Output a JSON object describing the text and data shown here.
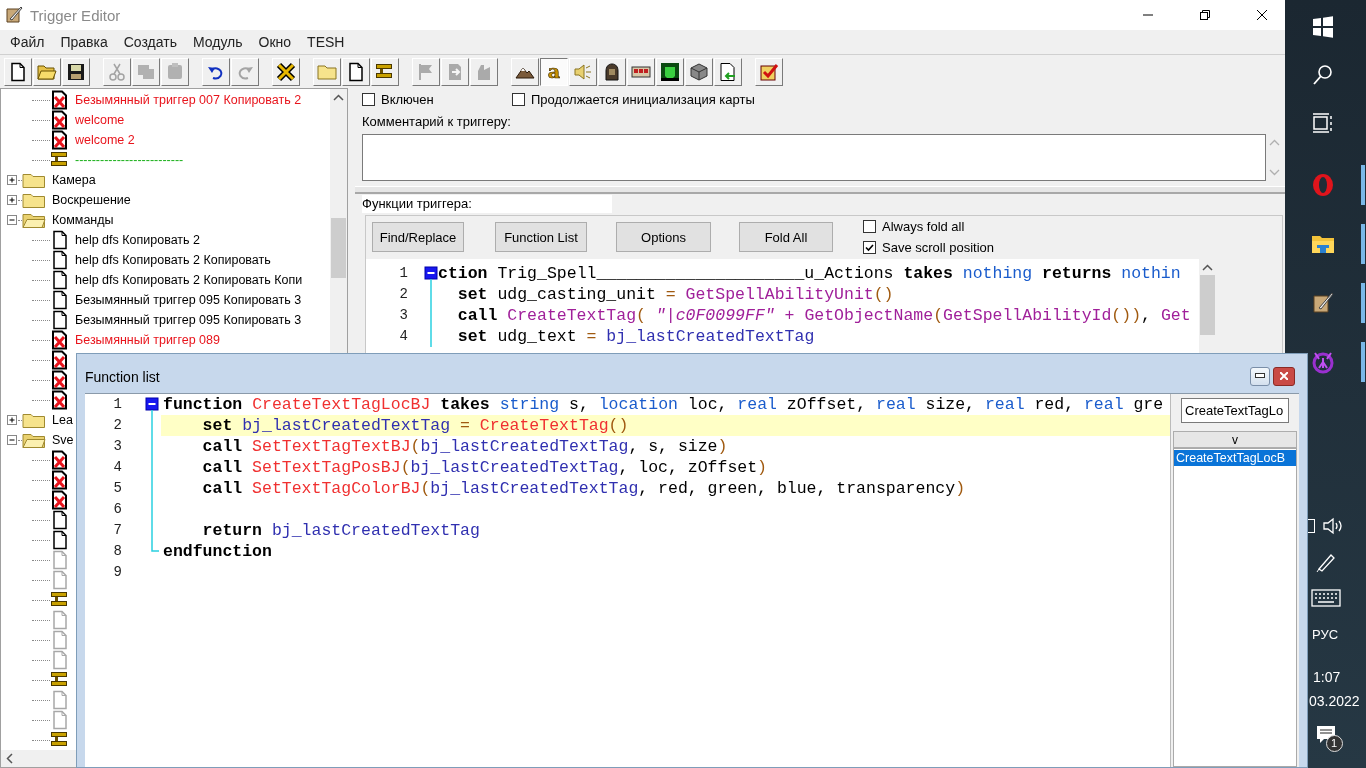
{
  "window": {
    "title": "Trigger Editor"
  },
  "menu": [
    "Файл",
    "Правка",
    "Создать",
    "Модуль",
    "Окно",
    "TESH"
  ],
  "toolbar": [
    [
      {
        "kind": "new",
        "disabled": false
      },
      {
        "kind": "open",
        "disabled": false
      },
      {
        "kind": "save",
        "disabled": false
      }
    ],
    [
      {
        "kind": "cut",
        "disabled": true
      },
      {
        "kind": "copy",
        "disabled": true
      },
      {
        "kind": "paste",
        "disabled": true
      }
    ],
    [
      {
        "kind": "undo",
        "disabled": false
      },
      {
        "kind": "redo",
        "disabled": true
      }
    ],
    [
      {
        "kind": "delete",
        "disabled": false
      }
    ],
    [
      {
        "kind": "folder",
        "disabled": false
      },
      {
        "kind": "trigger",
        "disabled": false
      },
      {
        "kind": "comment",
        "disabled": false
      }
    ],
    [
      {
        "kind": "flag",
        "disabled": true
      },
      {
        "kind": "export",
        "disabled": true
      },
      {
        "kind": "glove",
        "disabled": true
      }
    ],
    [
      {
        "kind": "terrain",
        "disabled": false,
        "pressed": false
      },
      {
        "kind": "text",
        "label": "a",
        "disabled": false,
        "pressed": true
      },
      {
        "kind": "sound",
        "disabled": false,
        "pressed": false
      },
      {
        "kind": "figure",
        "disabled": false,
        "pressed": false
      },
      {
        "kind": "panel",
        "disabled": false,
        "pressed": false
      },
      {
        "kind": "monster",
        "disabled": false,
        "pressed": false
      },
      {
        "kind": "cube",
        "disabled": false,
        "pressed": false
      },
      {
        "kind": "import",
        "disabled": false,
        "pressed": false
      }
    ],
    [
      {
        "kind": "check",
        "disabled": false
      }
    ]
  ],
  "tree": {
    "scrolled_children": [
      {
        "kind": "disabled",
        "label": "Безымянный триггер 007 Копировать 2"
      },
      {
        "kind": "disabled",
        "label": "welcome"
      },
      {
        "kind": "disabled",
        "label": "welcome 2"
      },
      {
        "kind": "comment",
        "label": "--------------------------"
      }
    ],
    "items": [
      {
        "kind": "folder",
        "label": "Камера",
        "expanded": false
      },
      {
        "kind": "folder",
        "label": "Воскрешение",
        "expanded": false
      },
      {
        "kind": "folder",
        "label": "Комманды",
        "expanded": true,
        "children": [
          {
            "kind": "enabled",
            "label": "help dfs Копировать 2"
          },
          {
            "kind": "enabled",
            "label": "help dfs Копировать 2 Копировать"
          },
          {
            "kind": "enabled",
            "label": "help dfs Копировать 2 Копировать Копи"
          },
          {
            "kind": "enabled",
            "label": "Безымянный триггер 095 Копировать 3"
          },
          {
            "kind": "enabled",
            "label": "Безымянный триггер 095 Копировать 3"
          },
          {
            "kind": "disabled",
            "label": "Безымянный триггер 089"
          },
          {
            "kind": "disabled"
          },
          {
            "kind": "disabled"
          },
          {
            "kind": "disabled"
          }
        ]
      },
      {
        "kind": "folder",
        "label": "Lea",
        "expanded": false
      },
      {
        "kind": "folder",
        "label": "Sve",
        "expanded": true,
        "children": [
          {
            "kind": "disabled"
          },
          {
            "kind": "disabled"
          },
          {
            "kind": "disabled"
          },
          {
            "kind": "enabled"
          },
          {
            "kind": "enabled"
          },
          {
            "kind": "greyed"
          },
          {
            "kind": "greyed"
          },
          {
            "kind": "comment"
          },
          {
            "kind": "greyed"
          },
          {
            "kind": "greyed"
          },
          {
            "kind": "greyed"
          },
          {
            "kind": "comment"
          },
          {
            "kind": "greyed"
          },
          {
            "kind": "greyed"
          },
          {
            "kind": "comment"
          }
        ]
      }
    ]
  },
  "trigger": {
    "flags": [
      {
        "label": "Включен",
        "checked": false
      },
      {
        "label": "Продолжается инициализация карты",
        "checked": false
      }
    ],
    "comment_label": "Комментарий к триггеру:",
    "functions_label": "Функции триггера:",
    "buttons": [
      "Find/Replace",
      "Function List",
      "Options",
      "Fold All"
    ],
    "options": [
      {
        "label": "Always fold all",
        "checked": false
      },
      {
        "label": "Save scroll position",
        "checked": true
      }
    ],
    "lines": [
      {
        "number": "1",
        "kind": "open",
        "selected": false,
        "tokens": [
          {
            "kind": "kw",
            "text": "ction"
          },
          {
            "kind": "plain",
            "text": " Trig_Spell_____________________u_Actions "
          },
          {
            "kind": "kw",
            "text": "takes "
          },
          {
            "kind": "type",
            "text": "nothing "
          },
          {
            "kind": "kw",
            "text": "returns "
          },
          {
            "kind": "type",
            "text": "nothin"
          }
        ]
      },
      {
        "number": "2",
        "kind": "body",
        "selected": false,
        "tokens": [
          {
            "kind": "kw",
            "text": "set"
          },
          {
            "kind": "plain",
            "text": " udg_casting_unit "
          },
          {
            "kind": "op",
            "text": "= "
          },
          {
            "kind": "native",
            "text": "GetSpellAbilityUnit"
          },
          {
            "kind": "op",
            "text": "()"
          }
        ]
      },
      {
        "number": "3",
        "kind": "body",
        "selected": false,
        "tokens": [
          {
            "kind": "kw",
            "text": "call "
          },
          {
            "kind": "native",
            "text": "CreateTextTag"
          },
          {
            "kind": "op",
            "text": "( "
          },
          {
            "kind": "str",
            "text": "\"|c0F0099FF\" "
          },
          {
            "kind": "native",
            "text": "+ GetObjectName"
          },
          {
            "kind": "op",
            "text": "("
          },
          {
            "kind": "native",
            "text": "GetSpellAbilityId"
          },
          {
            "kind": "op",
            "text": "())"
          },
          {
            "kind": "plain",
            "text": ", "
          },
          {
            "kind": "native",
            "text": "Get"
          }
        ]
      },
      {
        "number": "4",
        "kind": "body",
        "selected": false,
        "tokens": [
          {
            "kind": "kw",
            "text": "set"
          },
          {
            "kind": "plain",
            "text": " udg_text "
          },
          {
            "kind": "op",
            "text": "= "
          },
          {
            "kind": "global",
            "text": "bj_lastCreatedTextTag"
          }
        ]
      }
    ]
  },
  "function_list": {
    "title": "Function list",
    "search": {
      "value": "CreateTextTagLo"
    },
    "dropdown": "v",
    "results": [
      {
        "label": "CreateTextTagLocB",
        "selected": true
      }
    ],
    "lines": [
      {
        "number": "1",
        "kind": "open",
        "selected": false,
        "tokens": [
          {
            "kind": "kw",
            "text": "function "
          },
          {
            "kind": "bj",
            "text": "CreateTextTagLocBJ "
          },
          {
            "kind": "kw",
            "text": "takes "
          },
          {
            "kind": "type",
            "text": "string"
          },
          {
            "kind": "plain",
            "text": " s, "
          },
          {
            "kind": "type",
            "text": "location"
          },
          {
            "kind": "plain",
            "text": " loc, "
          },
          {
            "kind": "type",
            "text": "real"
          },
          {
            "kind": "plain",
            "text": " zOffset, "
          },
          {
            "kind": "type",
            "text": "real"
          },
          {
            "kind": "plain",
            "text": " size, "
          },
          {
            "kind": "type",
            "text": "real"
          },
          {
            "kind": "plain",
            "text": " red, "
          },
          {
            "kind": "type",
            "text": "real"
          },
          {
            "kind": "plain",
            "text": " gre"
          }
        ]
      },
      {
        "number": "2",
        "kind": "body",
        "selected": true,
        "tokens": [
          {
            "kind": "kw",
            "text": "set "
          },
          {
            "kind": "global",
            "text": "bj_lastCreatedTextTag"
          },
          {
            "kind": "op",
            "text": " = "
          },
          {
            "kind": "bj",
            "text": "CreateTextTag"
          },
          {
            "kind": "op",
            "text": "()"
          }
        ]
      },
      {
        "number": "3",
        "kind": "body",
        "selected": false,
        "tokens": [
          {
            "kind": "kw",
            "text": "call "
          },
          {
            "kind": "bj",
            "text": "SetTextTagTextBJ"
          },
          {
            "kind": "op",
            "text": "("
          },
          {
            "kind": "global",
            "text": "bj_lastCreatedTextTag"
          },
          {
            "kind": "plain",
            "text": ", s, size"
          },
          {
            "kind": "op",
            "text": ")"
          }
        ]
      },
      {
        "number": "4",
        "kind": "body",
        "selected": false,
        "tokens": [
          {
            "kind": "kw",
            "text": "call "
          },
          {
            "kind": "bj",
            "text": "SetTextTagPosBJ"
          },
          {
            "kind": "op",
            "text": "("
          },
          {
            "kind": "global",
            "text": "bj_lastCreatedTextTag"
          },
          {
            "kind": "plain",
            "text": ", loc, zOffset"
          },
          {
            "kind": "op",
            "text": ")"
          }
        ]
      },
      {
        "number": "5",
        "kind": "body",
        "selected": false,
        "tokens": [
          {
            "kind": "kw",
            "text": "call "
          },
          {
            "kind": "bj",
            "text": "SetTextTagColorBJ"
          },
          {
            "kind": "op",
            "text": "("
          },
          {
            "kind": "global",
            "text": "bj_lastCreatedTextTag"
          },
          {
            "kind": "plain",
            "text": ", red, green, blue, transparency"
          },
          {
            "kind": "op",
            "text": ")"
          }
        ]
      },
      {
        "number": "6",
        "kind": "body",
        "selected": false
      },
      {
        "number": "7",
        "kind": "body",
        "selected": false,
        "tokens": [
          {
            "kind": "kw",
            "text": "return "
          },
          {
            "kind": "global",
            "text": "bj_lastCreatedTextTag"
          }
        ]
      },
      {
        "number": "8",
        "kind": "close",
        "selected": false,
        "tokens": [
          {
            "kind": "kw",
            "text": "endfunction"
          }
        ]
      },
      {
        "number": "9",
        "kind": "plain",
        "selected": false
      }
    ]
  },
  "taskbar": {
    "apps": [
      {
        "kind": "start",
        "running": false
      },
      {
        "kind": "search",
        "running": false
      },
      {
        "kind": "taskview",
        "running": false
      },
      {
        "kind": "opera",
        "running": true
      },
      {
        "kind": "explorer",
        "running": true
      },
      {
        "kind": "editor",
        "running": true
      },
      {
        "kind": "game",
        "running": true
      }
    ],
    "language": "РУС",
    "time": "1:07",
    "date": "03.2022",
    "notifications": "1"
  }
}
